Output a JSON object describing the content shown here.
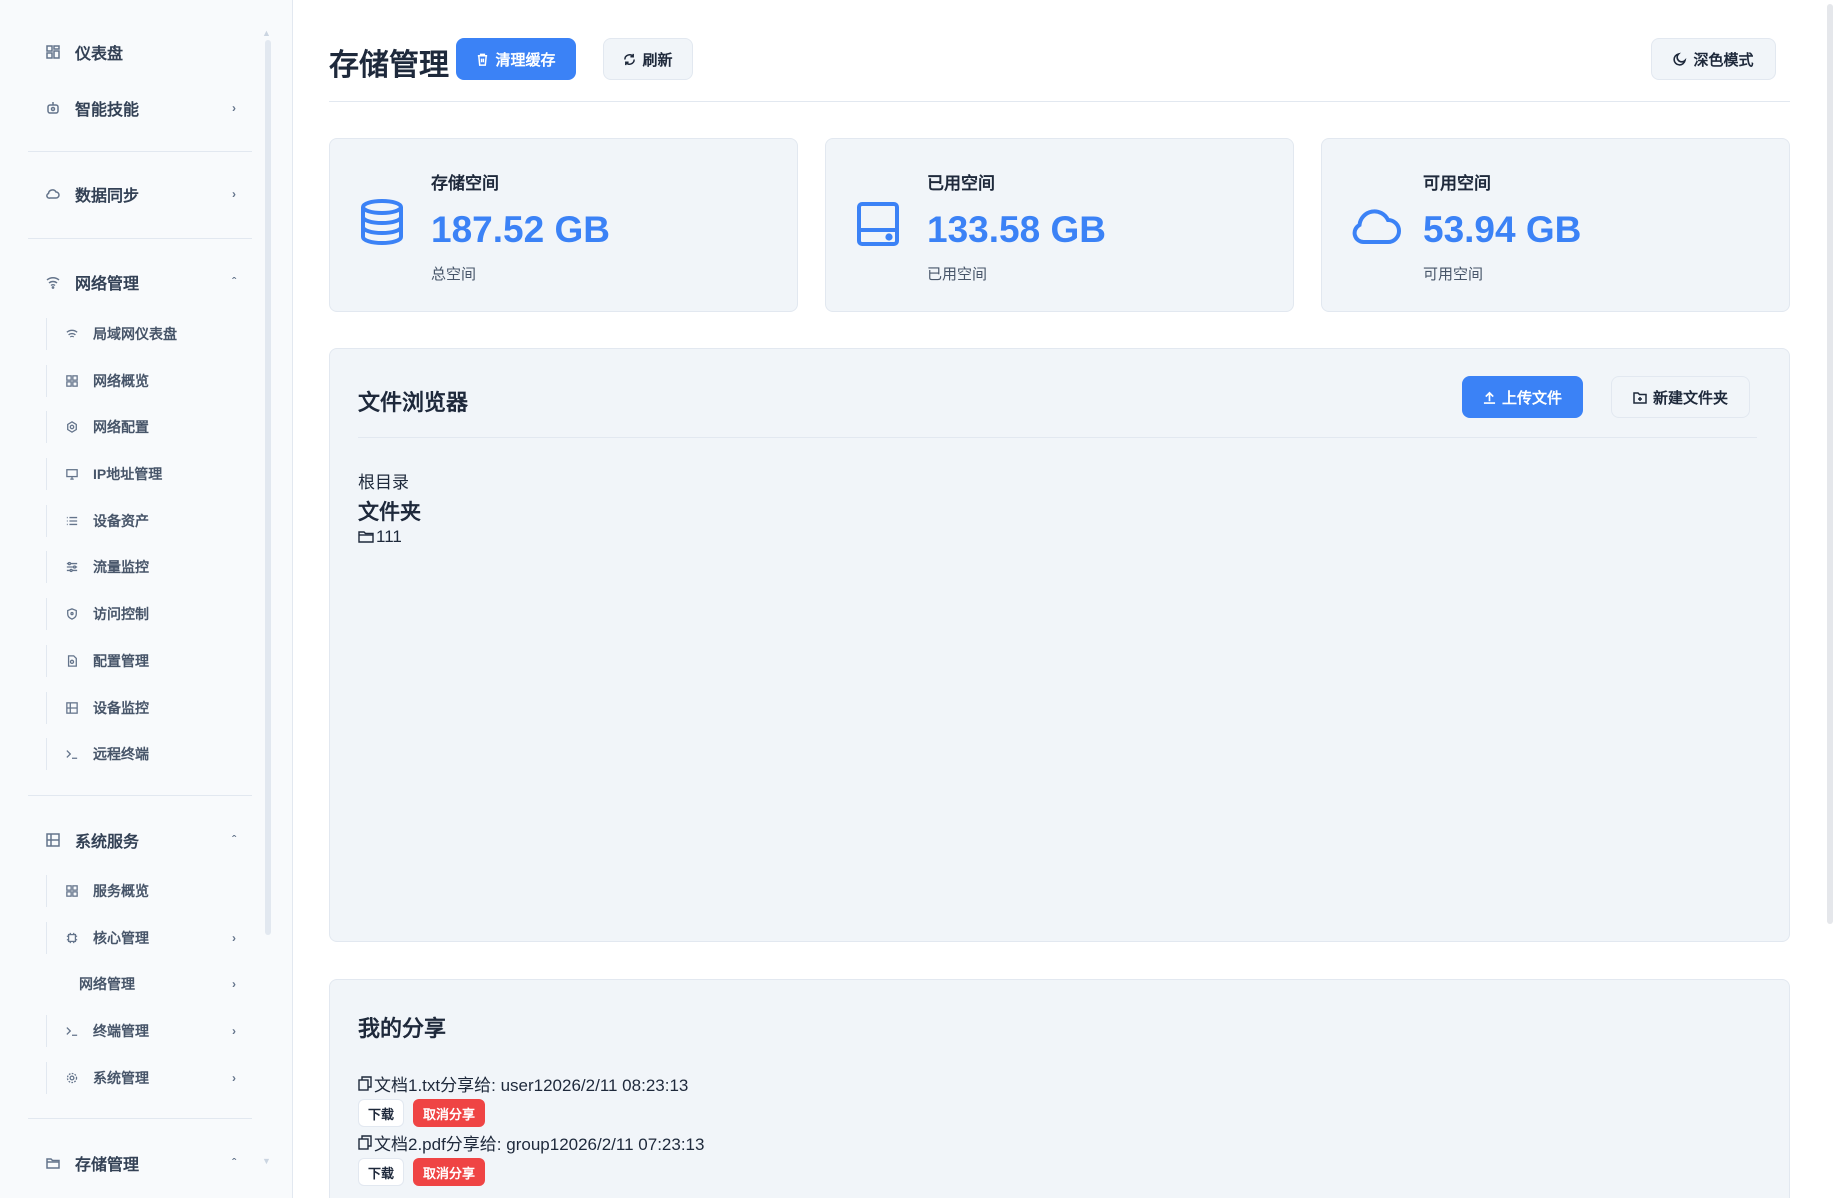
{
  "sidebar": {
    "dashboard": "仪表盘",
    "skills": "智能技能",
    "sync": "数据同步",
    "network": "网络管理",
    "network_children": [
      "局域网仪表盘",
      "网络概览",
      "网络配置",
      "IP地址管理",
      "设备资产",
      "流量监控",
      "访问控制",
      "配置管理",
      "设备监控",
      "远程终端"
    ],
    "services": "系统服务",
    "services_children": [
      "服务概览",
      "核心管理",
      "网络管理",
      "终端管理",
      "系统管理"
    ],
    "storage": "存储管理"
  },
  "header": {
    "title": "存储管理",
    "clear_cache": "清理缓存",
    "refresh": "刷新",
    "dark_mode": "深色模式"
  },
  "stats": [
    {
      "label": "存储空间",
      "value": "187.52 GB",
      "sub": "总空间",
      "icon": "database-icon"
    },
    {
      "label": "已用空间",
      "value": "133.58 GB",
      "sub": "已用空间",
      "icon": "hard-drive-icon"
    },
    {
      "label": "可用空间",
      "value": "53.94 GB",
      "sub": "可用空间",
      "icon": "cloud-icon"
    }
  ],
  "file_browser": {
    "title": "文件浏览器",
    "upload": "上传文件",
    "new_folder": "新建文件夹",
    "root": "根目录",
    "folders_heading": "文件夹",
    "folders": [
      "111"
    ]
  },
  "shares": {
    "title": "我的分享",
    "items": [
      {
        "text": "文档1.txt分享给: user12026/2/11 08:23:13",
        "download": "下载",
        "cancel": "取消分享"
      },
      {
        "text": "文档2.pdf分享给: group12026/2/11 07:23:13",
        "download": "下载",
        "cancel": "取消分享"
      }
    ]
  },
  "colors": {
    "accent": "#3b82f6",
    "danger": "#ef4444",
    "card_bg": "#f1f5f9"
  }
}
